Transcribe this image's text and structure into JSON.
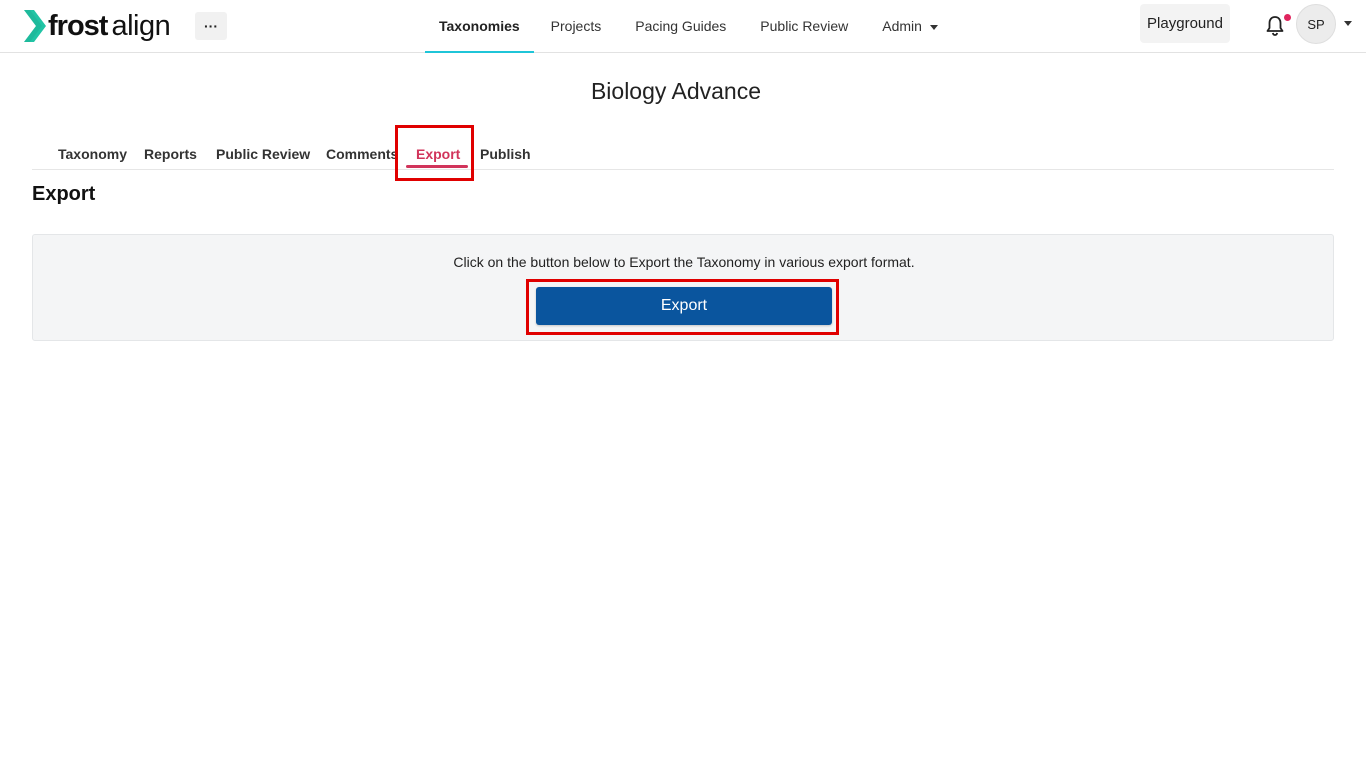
{
  "header": {
    "logo_frost": "frost",
    "logo_align": "align",
    "more_label": "···",
    "nav": [
      {
        "label": "Taxonomies",
        "active": true
      },
      {
        "label": "Projects"
      },
      {
        "label": "Pacing Guides"
      },
      {
        "label": "Public Review"
      },
      {
        "label": "Admin"
      }
    ],
    "playground_label": "Playground",
    "avatar_initials": "SP"
  },
  "page": {
    "title": "Biology Advance",
    "tabs": [
      {
        "label": "Taxonomy"
      },
      {
        "label": "Reports"
      },
      {
        "label": "Public Review"
      },
      {
        "label": "Comments"
      },
      {
        "label": "Export",
        "active": true
      },
      {
        "label": "Publish"
      }
    ],
    "section_title": "Export",
    "panel_text": "Click on the button below to Export the Taxonomy in various export format.",
    "export_button_label": "Export"
  },
  "colors": {
    "logo_accent": "#21c4a5",
    "nav_active_underline": "#1fc5d8",
    "tab_active": "#d1345b",
    "export_button": "#0a559e",
    "highlight_box": "#e00000",
    "notification_dot": "#e0245e"
  },
  "icons": {
    "logo": "frost-chevron-icon",
    "bell": "bell-icon"
  }
}
